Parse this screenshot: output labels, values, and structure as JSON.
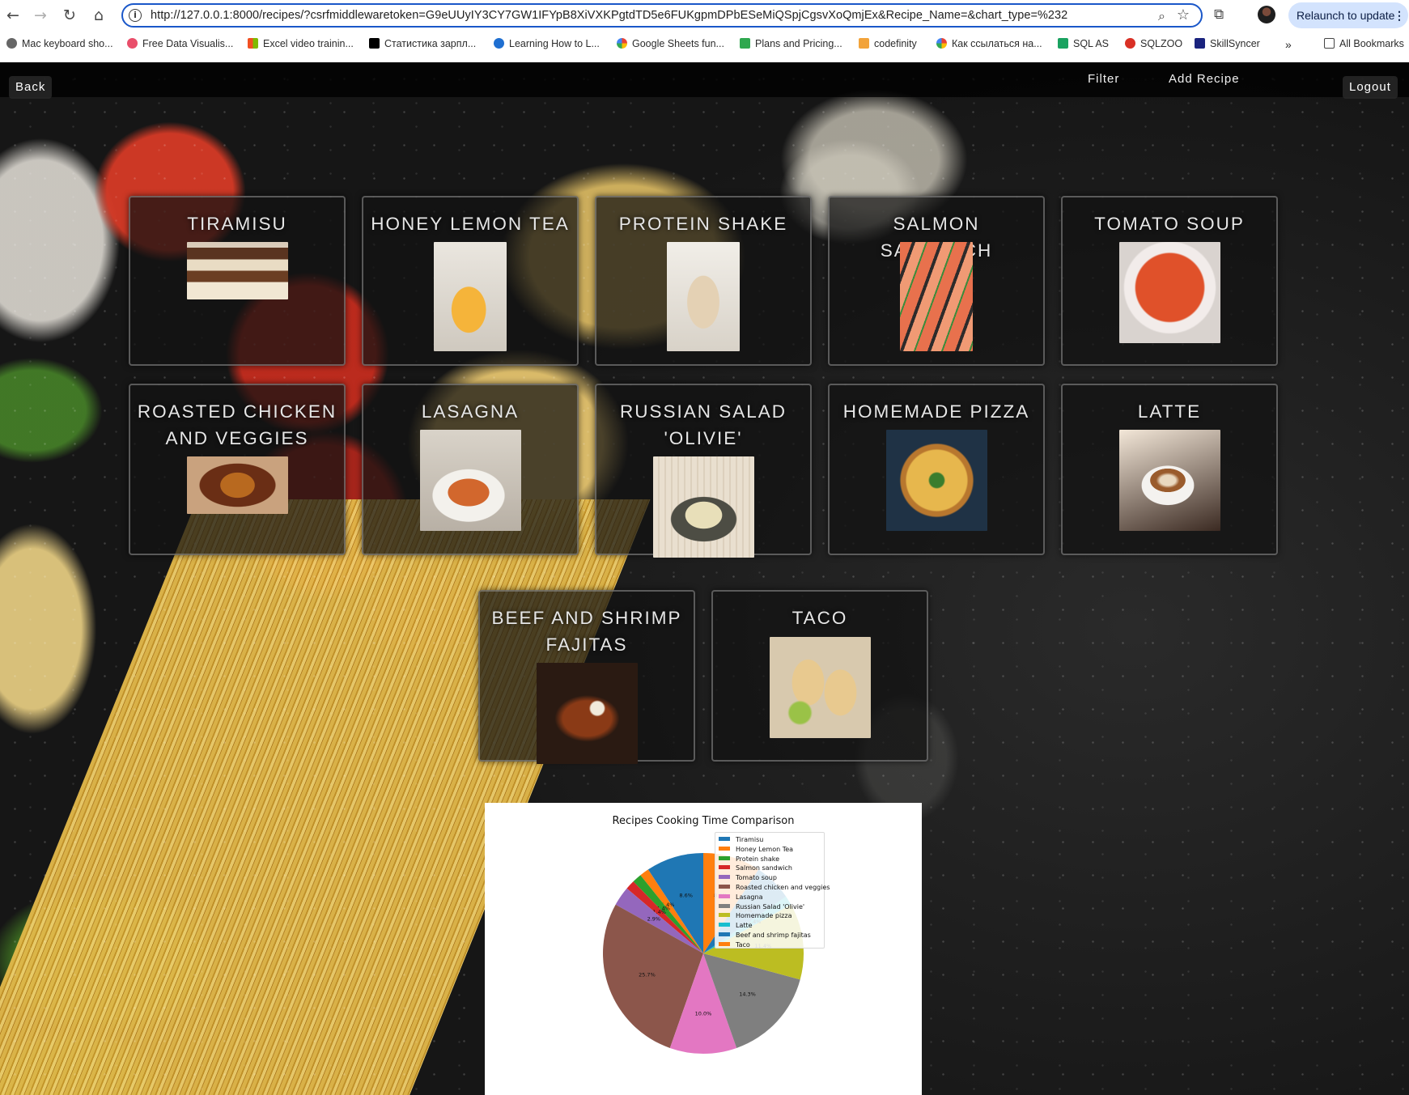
{
  "browser": {
    "url": "http://127.0.0.1:8000/recipes/?csrfmiddlewaretoken=G9eUUyIY3CY7GW1IFYpB8XiVXKPgtdTD5e6FUKgpmDPbESeMiQSpjCgsvXoQmjEx&Recipe_Name=&chart_type=%232",
    "relaunch_label": "Relaunch to update",
    "bookmarks": [
      {
        "label": "Mac keyboard sho...",
        "color": "#666666"
      },
      {
        "label": "Free Data Visualis...",
        "color": "#e94e6a"
      },
      {
        "label": "Excel video trainin...",
        "color": "#f25022"
      },
      {
        "label": "Статистика зарпл...",
        "color": "#000000"
      },
      {
        "label": "Learning How to L...",
        "color": "#1f6fd1"
      },
      {
        "label": "Google Sheets fun...",
        "color": "#4285f4"
      },
      {
        "label": "Plans and Pricing...",
        "color": "#2fa84f"
      },
      {
        "label": "codefinity",
        "color": "#f2a33a"
      },
      {
        "label": "Как ссылаться на...",
        "color": "#4285f4"
      },
      {
        "label": "SQL AS",
        "color": "#1aa260"
      },
      {
        "label": "SQLZOO",
        "color": "#d93025"
      },
      {
        "label": "SkillSyncer",
        "color": "#1a237e"
      }
    ],
    "all_bookmarks_label": "All Bookmarks"
  },
  "nav": {
    "back_label": "Back",
    "filter_label": "Filter",
    "add_recipe_label": "Add Recipe",
    "logout_label": "Logout"
  },
  "recipes": [
    {
      "name": "Tiramisu",
      "photo": "tiramisu"
    },
    {
      "name": "Honey Lemon Tea",
      "photo": "honey-lemon-tea"
    },
    {
      "name": "Protein Shake",
      "photo": "protein-shake"
    },
    {
      "name": "Salmon Sandwich",
      "photo": "salmon-sandwich"
    },
    {
      "name": "Tomato Soup",
      "photo": "tomato-soup"
    },
    {
      "name": "Roasted Chicken and Veggies",
      "photo": "roasted-chicken"
    },
    {
      "name": "Lasagna",
      "photo": "lasagna"
    },
    {
      "name": "Russian Salad 'Olivie'",
      "photo": "russian-salad"
    },
    {
      "name": "Homemade Pizza",
      "photo": "pizza"
    },
    {
      "name": "Latte",
      "photo": "latte"
    },
    {
      "name": "Beef and Shrimp Fajitas",
      "photo": "fajitas"
    },
    {
      "name": "Taco",
      "photo": "taco"
    }
  ],
  "chart_data": {
    "type": "pie",
    "title": "Recipes Cooking Time Comparison",
    "legend_position": "top-right",
    "labels": [
      "Tiramisu",
      "Honey Lemon Tea",
      "Protein shake",
      "Salmon sandwich",
      "Tomato soup",
      "Roasted chicken and veggies",
      "Lasagna",
      "Russian Salad 'Olivie'",
      "Homemade pizza",
      "Latte",
      "Beef and shrimp fajitas",
      "Taco"
    ],
    "values": [
      8.6,
      1.4,
      1.4,
      1.4,
      2.9,
      25.7,
      10.0,
      14.3,
      11.4,
      1.4,
      5.7,
      8.6
    ],
    "value_labels": [
      "8.6%",
      "1.4%",
      "1.4%",
      "1.4%",
      "2.9%",
      "25.7%",
      "10.0%",
      "14.3%",
      "11.4%",
      "1.4%",
      "5.7%",
      "8.6%"
    ],
    "colors": [
      "#1f77b4",
      "#ff7f0e",
      "#2ca02c",
      "#d62728",
      "#9467bd",
      "#8c564b",
      "#e377c2",
      "#7f7f7f",
      "#bcbd22",
      "#17becf",
      "#1f77b4",
      "#ff7f0e"
    ]
  }
}
